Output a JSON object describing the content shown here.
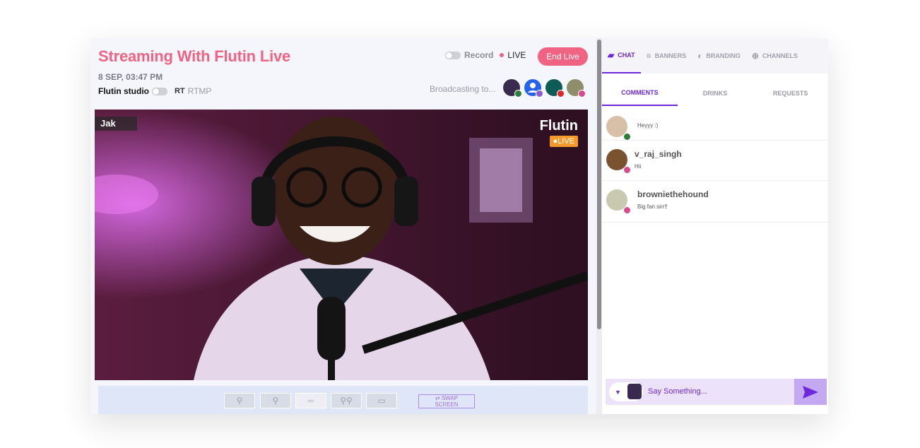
{
  "stream": {
    "title": "Streaming With Flutin Live",
    "datetime": "8 SEP, 03:47 PM",
    "studio_label": "Flutin studio",
    "rtmp_label": "RTMP",
    "record_label": "Record",
    "live_label": "LIVE",
    "end_live_label": "End Live",
    "broadcasting_label": "Broadcasting to...",
    "channels": [
      {
        "name": "avatar",
        "color": "#3b2a4f",
        "badge": "#2d7d3a"
      },
      {
        "name": "profile",
        "color": "#2563eb",
        "badge": "#8a5cd6"
      },
      {
        "name": "channel",
        "color": "#0f5b55",
        "badge": "#e0262c"
      },
      {
        "name": "brand",
        "color": "#8f8e6a",
        "badge": "#d84a8a"
      }
    ]
  },
  "video": {
    "name_tag": "Jak",
    "watermark_name": "Flutin",
    "watermark_live": "●LIVE"
  },
  "layout_bar": {
    "swap_label": "⇄ SWAP SCREEN"
  },
  "tabs": [
    {
      "label": "CHAT",
      "icon": "chat-icon",
      "glyph": "▰",
      "active": true
    },
    {
      "label": "BANNERS",
      "icon": "banners-icon",
      "glyph": "≡",
      "active": false
    },
    {
      "label": "BRANDING",
      "icon": "palette-icon",
      "glyph": "◐",
      "active": false
    },
    {
      "label": "CHANNELS",
      "icon": "globe-icon",
      "glyph": "⊕",
      "active": false
    }
  ],
  "subtabs": [
    {
      "label": "COMMENTS",
      "active": true
    },
    {
      "label": "DRINKS",
      "active": false
    },
    {
      "label": "REQUESTS",
      "active": false
    }
  ],
  "messages": [
    {
      "user": "",
      "text": "Heyyy :)",
      "badge": "#2d7d3a"
    },
    {
      "user": "v_raj_singh",
      "text": "Hii",
      "badge": "#d84a8a"
    },
    {
      "user": "browniethehound",
      "text": "Big fan sirr!!",
      "badge": "#d84a8a"
    }
  ],
  "compose": {
    "placeholder": "Say Something..."
  },
  "colors": {
    "accent": "#6d28d9",
    "brand_pink": "#f06383",
    "live_orange": "#f49a2a"
  }
}
